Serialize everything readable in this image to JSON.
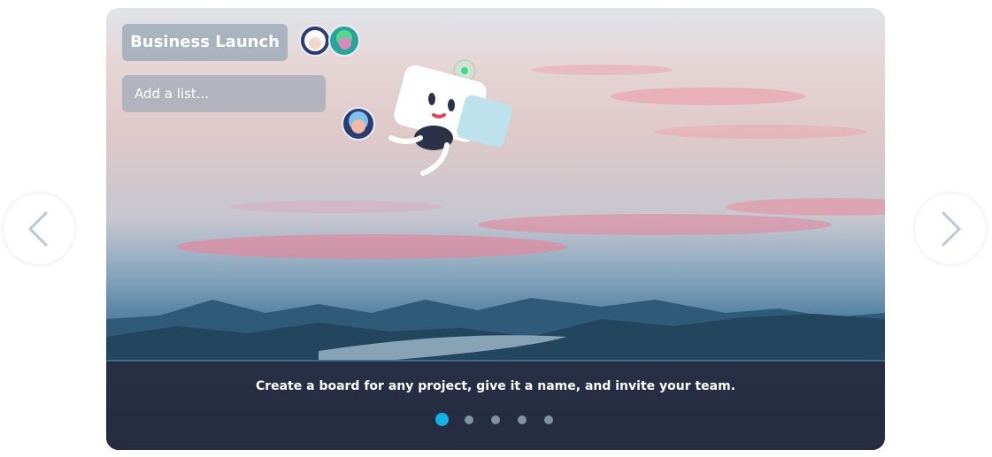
{
  "board": {
    "title": "Business Launch",
    "add_list_placeholder": "Add a list..."
  },
  "caption": "Create a board for any project, give it a name, and invite your team.",
  "carousel": {
    "slide_count": 5,
    "active_index": 0
  },
  "icons": {
    "prev": "chevron-left-icon",
    "next": "chevron-right-icon"
  },
  "colors": {
    "dot_active": "#11b3e6",
    "dot_inactive": "#7f93a5",
    "caption_bg": "#262b40"
  }
}
